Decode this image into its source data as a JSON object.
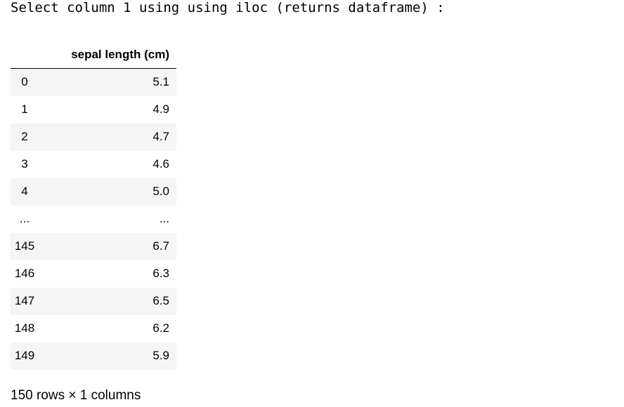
{
  "output_text": "Select column 1 using using iloc (returns dataframe) :",
  "dataframe": {
    "column_header": "sepal length (cm)",
    "rows": [
      {
        "index": "0",
        "value": "5.1"
      },
      {
        "index": "1",
        "value": "4.9"
      },
      {
        "index": "2",
        "value": "4.7"
      },
      {
        "index": "3",
        "value": "4.6"
      },
      {
        "index": "4",
        "value": "5.0"
      },
      {
        "index": "...",
        "value": "..."
      },
      {
        "index": "145",
        "value": "6.7"
      },
      {
        "index": "146",
        "value": "6.3"
      },
      {
        "index": "147",
        "value": "6.5"
      },
      {
        "index": "148",
        "value": "6.2"
      },
      {
        "index": "149",
        "value": "5.9"
      }
    ]
  },
  "footer": "150 rows × 1 columns"
}
